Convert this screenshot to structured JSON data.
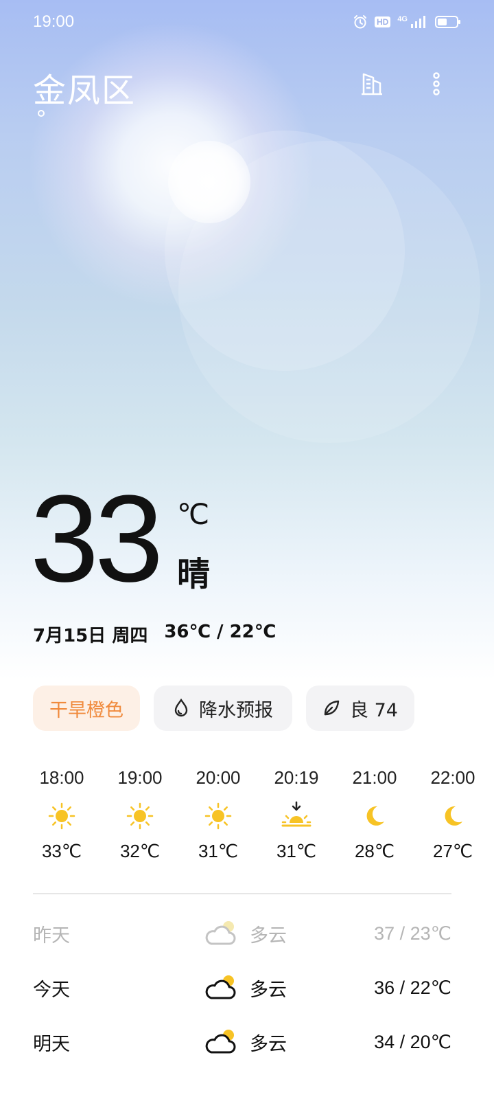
{
  "status_bar": {
    "time": "19:00",
    "hd_label": "HD",
    "network_label": "4G",
    "battery_fill": 0.5
  },
  "header": {
    "city": "金凤区"
  },
  "current": {
    "temperature": "33",
    "unit": "℃",
    "condition": "晴",
    "date": "7月15日 周四",
    "range": "36℃ / 22℃"
  },
  "chips": {
    "warning": "干旱橙色",
    "rain": "降水预报",
    "aqi": "良 74"
  },
  "hourly": [
    {
      "time": "18:00",
      "icon": "sun-icon",
      "temp": "33℃"
    },
    {
      "time": "19:00",
      "icon": "sun-icon",
      "temp": "32℃"
    },
    {
      "time": "20:00",
      "icon": "sun-icon",
      "temp": "31℃"
    },
    {
      "time": "20:19",
      "icon": "sunset-icon",
      "temp": "31℃"
    },
    {
      "time": "21:00",
      "icon": "moon-icon",
      "temp": "28℃"
    },
    {
      "time": "22:00",
      "icon": "moon-icon",
      "temp": "27℃"
    }
  ],
  "daily": [
    {
      "day": "昨天",
      "icon": "partly-cloudy-icon",
      "condition": "多云",
      "range": "37 / 23℃",
      "past": true
    },
    {
      "day": "今天",
      "icon": "partly-cloudy-icon",
      "condition": "多云",
      "range": "36 / 22℃",
      "past": false
    },
    {
      "day": "明天",
      "icon": "partly-cloudy-icon",
      "condition": "多云",
      "range": "34 / 20℃",
      "past": false
    }
  ],
  "colors": {
    "accent_warning": "#f08a3c",
    "icon_yellow": "#f7c325",
    "past_text": "#b5b5b5"
  }
}
